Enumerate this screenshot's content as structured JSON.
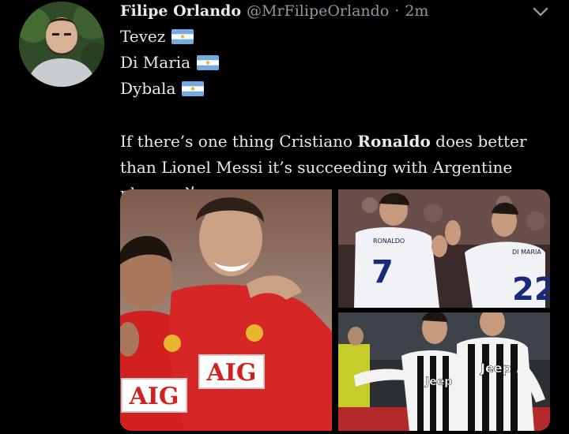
{
  "tweet": {
    "author_name": "Filipe Orlando",
    "handle": "@MrFilipeOrlando",
    "separator": "·",
    "time": "2m",
    "lines": [
      "Tevez",
      "Di Maria",
      "Dybala"
    ],
    "text_before": "If there’s one thing Cristiano ",
    "text_bold": "Ronaldo",
    "text_after": " does better than Lionel Messi it’s succeeding with Argentine players"
  },
  "media": {
    "sponsor_text": "AIG",
    "shirt_number_left": "7",
    "shirt_number_right": "22",
    "shirt_name_left": "RONALDO",
    "shirt_name_right": "DI MARIA",
    "sponsor_juve": "Jeep"
  },
  "icons": {
    "flag": "argentina-flag-icon",
    "goat": "goat-icon",
    "menu": "chevron-down-icon"
  }
}
